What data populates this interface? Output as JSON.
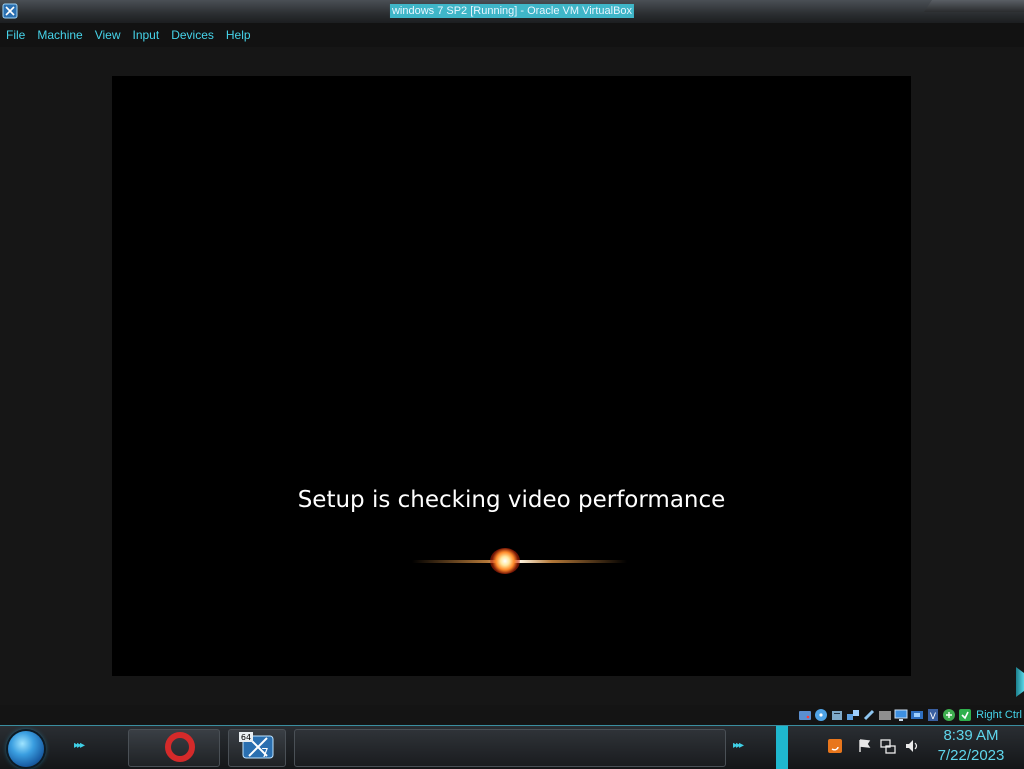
{
  "window": {
    "title": "windows 7 SP2 [Running] - Oracle VM VirtualBox"
  },
  "menubar": {
    "items": [
      {
        "label": "File"
      },
      {
        "label": "Machine"
      },
      {
        "label": "View"
      },
      {
        "label": "Input"
      },
      {
        "label": "Devices"
      },
      {
        "label": "Help"
      }
    ]
  },
  "guest_screen": {
    "message": "Setup is checking video performance"
  },
  "statusbar": {
    "icons": [
      "hard-disk-icon",
      "optical-drive-icon",
      "audio-icon",
      "network-icon",
      "usb-icon",
      "shared-folders-icon",
      "display-icon",
      "recording-icon",
      "cpu-icon",
      "mouse-integration-icon",
      "host-key-icon"
    ],
    "host_key": "Right Ctrl"
  },
  "taskbar": {
    "pinned": [
      {
        "name": "opera-icon"
      },
      {
        "name": "windows7-vm-icon",
        "badge": "64"
      }
    ],
    "tray_icons": [
      "java-icon",
      "action-center-flag-icon",
      "network-icon",
      "volume-icon"
    ],
    "clock_time": "8:39 AM",
    "clock_date": "7/22/2023"
  },
  "colors": {
    "accent": "#46d4ea",
    "title_highlight": "#3fb6c8",
    "vm_background": "#000000",
    "taskbar_bg": "#1c1f22"
  }
}
